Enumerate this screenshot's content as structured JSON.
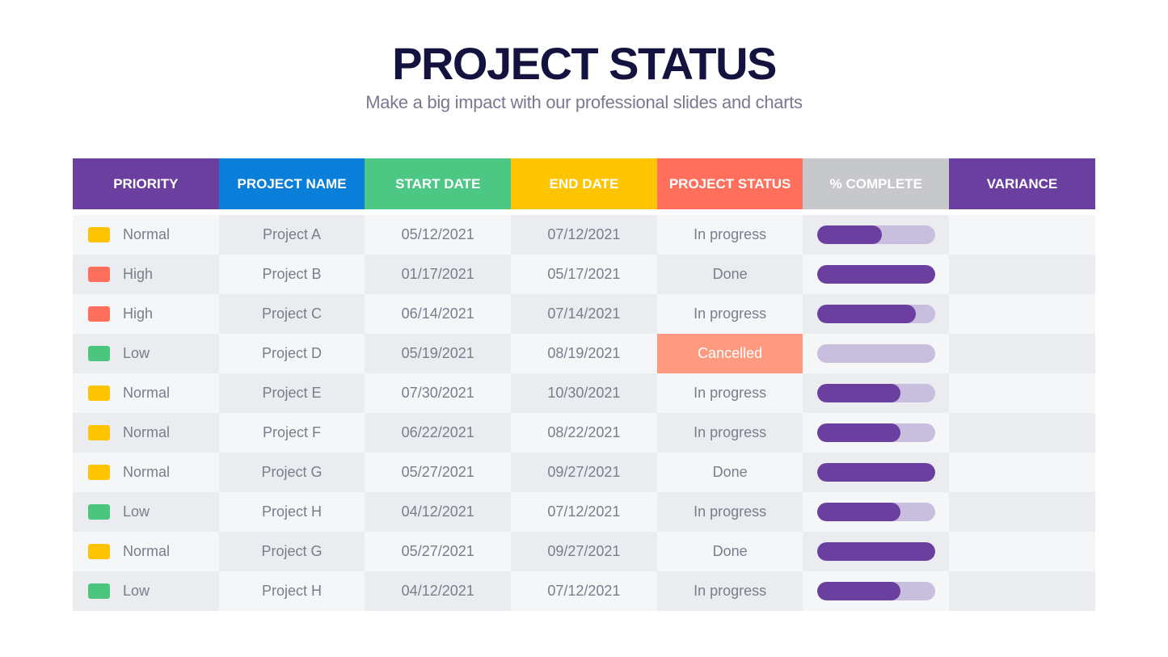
{
  "title": "PROJECT STATUS",
  "subtitle": "Make a big impact with our professional slides and charts",
  "colors": {
    "priority": {
      "Normal": "#ffc400",
      "High": "#ff6f5b",
      "Low": "#4cc67f"
    },
    "bar_fill": "#6b3fa0",
    "bar_track": "#c8bedd",
    "cancelled_bg": "#ff9a80"
  },
  "headers": [
    {
      "label": "PRIORITY",
      "color": "#6b3fa0"
    },
    {
      "label": "PROJECT NAME",
      "color": "#0a7fd9"
    },
    {
      "label": "START DATE",
      "color": "#4cc784"
    },
    {
      "label": "END DATE",
      "color": "#ffc400"
    },
    {
      "label": "PROJECT STATUS",
      "color": "#ff6f5b"
    },
    {
      "label": "% COMPLETE",
      "color": "#c6c8cc"
    },
    {
      "label": "VARIANCE",
      "color": "#6b3fa0"
    }
  ],
  "rows": [
    {
      "priority": "Normal",
      "name": "Project A",
      "start": "05/12/2021",
      "end": "07/12/2021",
      "status": "In progress",
      "complete": 55,
      "variance": ""
    },
    {
      "priority": "High",
      "name": "Project B",
      "start": "01/17/2021",
      "end": "05/17/2021",
      "status": "Done",
      "complete": 100,
      "variance": ""
    },
    {
      "priority": "High",
      "name": "Project C",
      "start": "06/14/2021",
      "end": "07/14/2021",
      "status": "In progress",
      "complete": 84,
      "variance": ""
    },
    {
      "priority": "Low",
      "name": "Project D",
      "start": "05/19/2021",
      "end": "08/19/2021",
      "status": "Cancelled",
      "complete": 0,
      "variance": ""
    },
    {
      "priority": "Normal",
      "name": "Project E",
      "start": "07/30/2021",
      "end": "10/30/2021",
      "status": "In progress",
      "complete": 71,
      "variance": ""
    },
    {
      "priority": "Normal",
      "name": "Project F",
      "start": "06/22/2021",
      "end": "08/22/2021",
      "status": "In progress",
      "complete": 71,
      "variance": ""
    },
    {
      "priority": "Normal",
      "name": "Project G",
      "start": "05/27/2021",
      "end": "09/27/2021",
      "status": "Done",
      "complete": 100,
      "variance": ""
    },
    {
      "priority": "Low",
      "name": "Project H",
      "start": "04/12/2021",
      "end": "07/12/2021",
      "status": "In progress",
      "complete": 71,
      "variance": ""
    },
    {
      "priority": "Normal",
      "name": "Project G",
      "start": "05/27/2021",
      "end": "09/27/2021",
      "status": "Done",
      "complete": 100,
      "variance": ""
    },
    {
      "priority": "Low",
      "name": "Project H",
      "start": "04/12/2021",
      "end": "07/12/2021",
      "status": "In progress",
      "complete": 71,
      "variance": ""
    }
  ]
}
